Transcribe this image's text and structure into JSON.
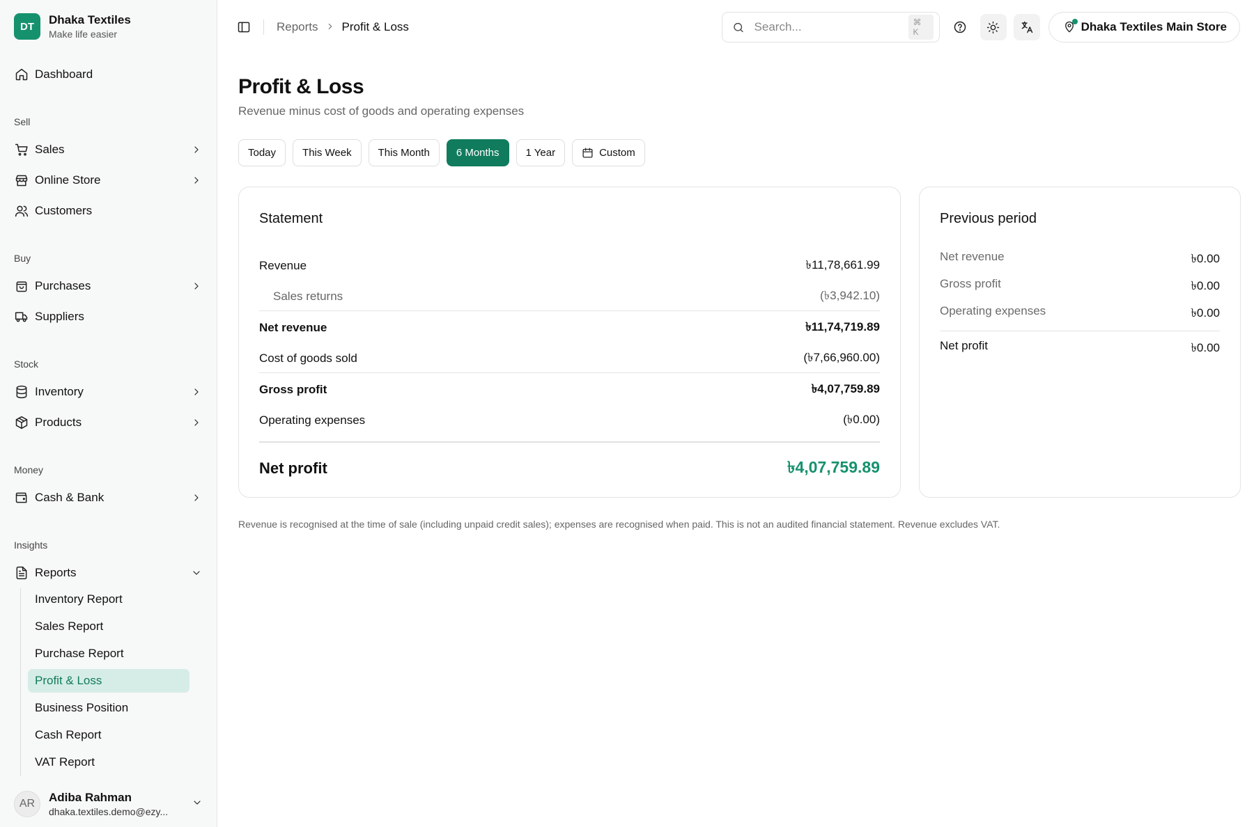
{
  "brand": {
    "initials": "DT",
    "name": "Dhaka Textiles",
    "tagline": "Make life easier"
  },
  "sidebar": {
    "dashboard": "Dashboard",
    "sections": {
      "sell": "Sell",
      "buy": "Buy",
      "stock": "Stock",
      "money": "Money",
      "insights": "Insights"
    },
    "items": {
      "sales": "Sales",
      "online_store": "Online Store",
      "customers": "Customers",
      "purchases": "Purchases",
      "suppliers": "Suppliers",
      "inventory": "Inventory",
      "products": "Products",
      "cash_bank": "Cash & Bank",
      "reports": "Reports"
    },
    "reports_sub": [
      "Inventory Report",
      "Sales Report",
      "Purchase Report",
      "Profit & Loss",
      "Business Position",
      "Cash Report",
      "VAT Report"
    ],
    "active_sub": "Profit & Loss"
  },
  "user": {
    "initials": "AR",
    "name": "Adiba Rahman",
    "email": "dhaka.textiles.demo@ezy..."
  },
  "topbar": {
    "breadcrumb_parent": "Reports",
    "breadcrumb_current": "Profit & Loss",
    "search_placeholder": "Search...",
    "search_shortcut": "⌘ K",
    "store_name": "Dhaka Textiles Main Store"
  },
  "page": {
    "title": "Profit & Loss",
    "subtitle": "Revenue minus cost of goods and operating expenses"
  },
  "ranges": [
    "Today",
    "This Week",
    "This Month",
    "6 Months",
    "1 Year",
    "Custom"
  ],
  "active_range": "6 Months",
  "statement": {
    "title": "Statement",
    "revenue_label": "Revenue",
    "revenue_value": "৳11,78,661.99",
    "returns_label": "Sales returns",
    "returns_value": "(৳3,942.10)",
    "net_revenue_label": "Net revenue",
    "net_revenue_value": "৳11,74,719.89",
    "cogs_label": "Cost of goods sold",
    "cogs_value": "(৳7,66,960.00)",
    "gross_label": "Gross profit",
    "gross_value": "৳4,07,759.89",
    "opex_label": "Operating expenses",
    "opex_value": "(৳0.00)",
    "net_profit_label": "Net profit",
    "net_profit_value": "৳4,07,759.89"
  },
  "previous": {
    "title": "Previous period",
    "net_revenue_label": "Net revenue",
    "net_revenue_value": "৳0.00",
    "gross_label": "Gross profit",
    "gross_value": "৳0.00",
    "opex_label": "Operating expenses",
    "opex_value": "৳0.00",
    "net_profit_label": "Net profit",
    "net_profit_value": "৳0.00"
  },
  "footnote": "Revenue is recognised at the time of sale (including unpaid credit sales); expenses are recognised when paid. This is not an audited financial statement. Revenue excludes VAT.",
  "colors": {
    "accent": "#107c5d",
    "profit": "#16916d",
    "active_bg": "#d6ede7"
  }
}
